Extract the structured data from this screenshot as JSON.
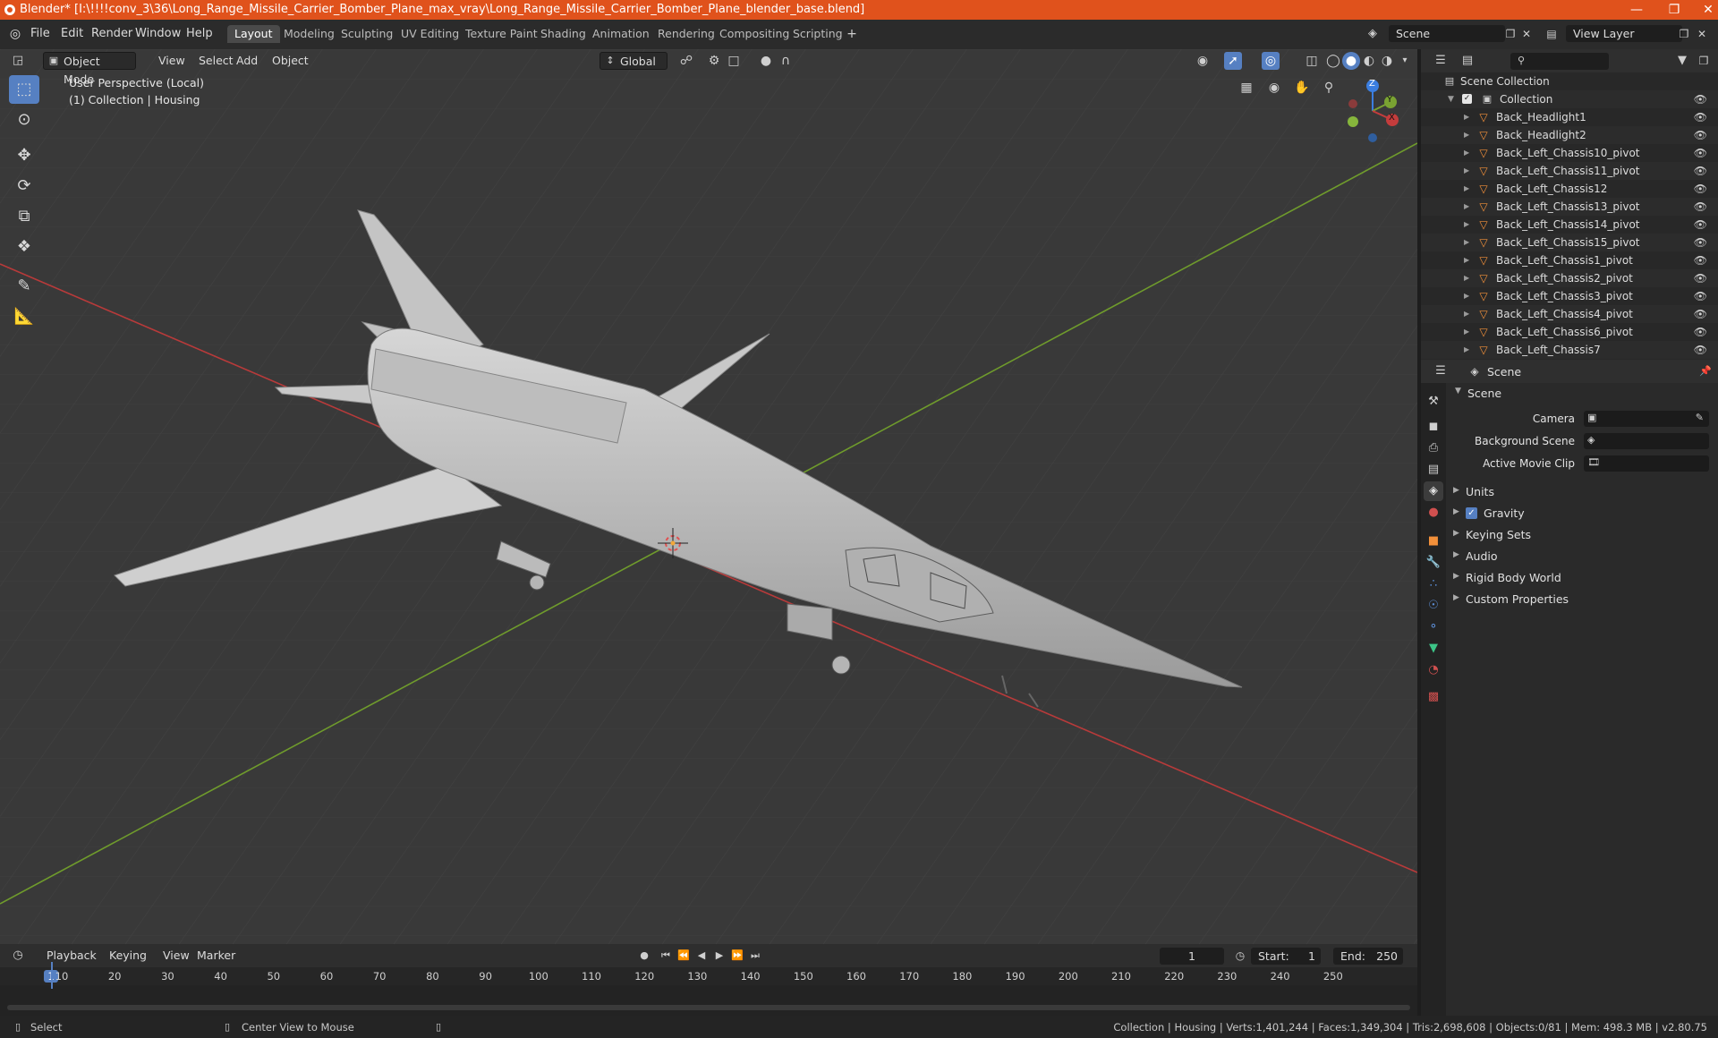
{
  "title_bar": {
    "title": "Blender* [I:\\!!!!conv_3\\36\\Long_Range_Missile_Carrier_Bomber_Plane_max_vray\\Long_Range_Missile_Carrier_Bomber_Plane_blender_base.blend]"
  },
  "menu": {
    "items": [
      "File",
      "Edit",
      "Render",
      "Window",
      "Help"
    ]
  },
  "workspaces": {
    "tabs": [
      "Layout",
      "Modeling",
      "Sculpting",
      "UV Editing",
      "Texture Paint",
      "Shading",
      "Animation",
      "Rendering",
      "Compositing",
      "Scripting"
    ],
    "active": "Layout"
  },
  "scene_selector": {
    "value": "Scene"
  },
  "view_layer": {
    "value": "View Layer"
  },
  "viewport_header": {
    "mode": "Object Mode",
    "view": "View",
    "select": "Select",
    "add": "Add",
    "object": "Object",
    "orientation": "Global"
  },
  "viewport": {
    "perspective": "User Perspective (Local)",
    "collection_info": "(1) Collection | Housing"
  },
  "gizmo": {
    "z": "Z",
    "y": "Y",
    "x": "X"
  },
  "outliner": {
    "scene_collection": "Scene Collection",
    "collection": "Collection",
    "items": [
      {
        "name": "Back_Headlight1",
        "mod": true
      },
      {
        "name": "Back_Headlight2",
        "mod": true
      },
      {
        "name": "Back_Left_Chassis10_pivot",
        "mod": true
      },
      {
        "name": "Back_Left_Chassis11_pivot",
        "mod": true
      },
      {
        "name": "Back_Left_Chassis12",
        "mod": true
      },
      {
        "name": "Back_Left_Chassis13_pivot",
        "mod": true
      },
      {
        "name": "Back_Left_Chassis14_pivot",
        "mod": true
      },
      {
        "name": "Back_Left_Chassis15_pivot",
        "mod": true
      },
      {
        "name": "Back_Left_Chassis1_pivot",
        "mod": true
      },
      {
        "name": "Back_Left_Chassis2_pivot",
        "mod": true
      },
      {
        "name": "Back_Left_Chassis3_pivot",
        "mod": true
      },
      {
        "name": "Back_Left_Chassis4_pivot",
        "mod": true
      },
      {
        "name": "Back_Left_Chassis6_pivot",
        "mod": true
      },
      {
        "name": "Back_Left_Chassis7",
        "mod": true
      }
    ]
  },
  "properties": {
    "header": "Scene",
    "section": "Scene",
    "camera_label": "Camera",
    "background_scene_label": "Background Scene",
    "active_movie_clip_label": "Active Movie Clip",
    "subpanels": [
      "Units",
      "Gravity",
      "Keying Sets",
      "Audio",
      "Rigid Body World",
      "Custom Properties"
    ],
    "gravity_checked": true
  },
  "timeline": {
    "playback": "Playback",
    "keying": "Keying",
    "view": "View",
    "marker": "Marker",
    "current_frame": "1",
    "start_label": "Start:",
    "start": "1",
    "end_label": "End:",
    "end": "250",
    "ruler": [
      "1",
      "10",
      "20",
      "30",
      "40",
      "50",
      "60",
      "70",
      "80",
      "90",
      "100",
      "110",
      "120",
      "130",
      "140",
      "150",
      "160",
      "170",
      "180",
      "190",
      "200",
      "210",
      "220",
      "230",
      "240",
      "250"
    ]
  },
  "status_bar": {
    "left": "Select",
    "middle": "Center View to Mouse",
    "stats": "Collection | Housing | Verts:1,401,244 | Faces:1,349,304 | Tris:2,698,608 | Objects:0/81 | Mem: 498.3 MB | v2.80.75"
  },
  "colors": {
    "accent": "#5680c2",
    "titlebar": "#e0521c",
    "x_axis": "#c43c3c",
    "y_axis": "#7aa332",
    "z_axis": "#3b7ee0"
  },
  "icons": [
    "blender-logo",
    "select-box-icon",
    "cursor-icon",
    "move-icon",
    "rotate-icon",
    "scale-icon",
    "transform-icon",
    "annotate-icon",
    "measure-icon",
    "eye-icon",
    "wrench-icon",
    "mesh-icon",
    "filter-icon"
  ]
}
